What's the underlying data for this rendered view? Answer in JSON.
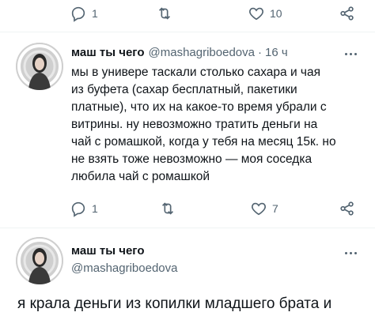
{
  "top_actions": {
    "reply_count": "1",
    "retweet_count": "",
    "like_count": "10"
  },
  "tweet1": {
    "author_name": "маш ты чего",
    "author_handle": "@mashagriboedova",
    "separator": "·",
    "time": "16 ч",
    "lines": [
      "мы в универе таскали столько сахара и чая",
      "из буфета (сахар бесплатный, пакетики",
      "платные), что их на какое-то время убрали с",
      "витрины. ну невозможно тратить деньги на",
      "чай с ромашкой, когда у тебя на месяц 15к. но",
      "не взять тоже невозможно — моя соседка",
      "любила чай с ромашкой"
    ],
    "reply_count": "1",
    "like_count": "7"
  },
  "tweet2": {
    "author_name": "маш ты чего",
    "author_handle": "@mashagriboedova",
    "text_line": "я крала деньги из копилки младшего брата и"
  },
  "icons": {
    "reply": "reply-icon",
    "retweet": "retweet-icon",
    "like": "heart-icon",
    "share": "share-icon",
    "more": "more-icon"
  },
  "colors": {
    "text": "#0f1419",
    "secondary": "#536471",
    "divider": "#eff3f4"
  }
}
